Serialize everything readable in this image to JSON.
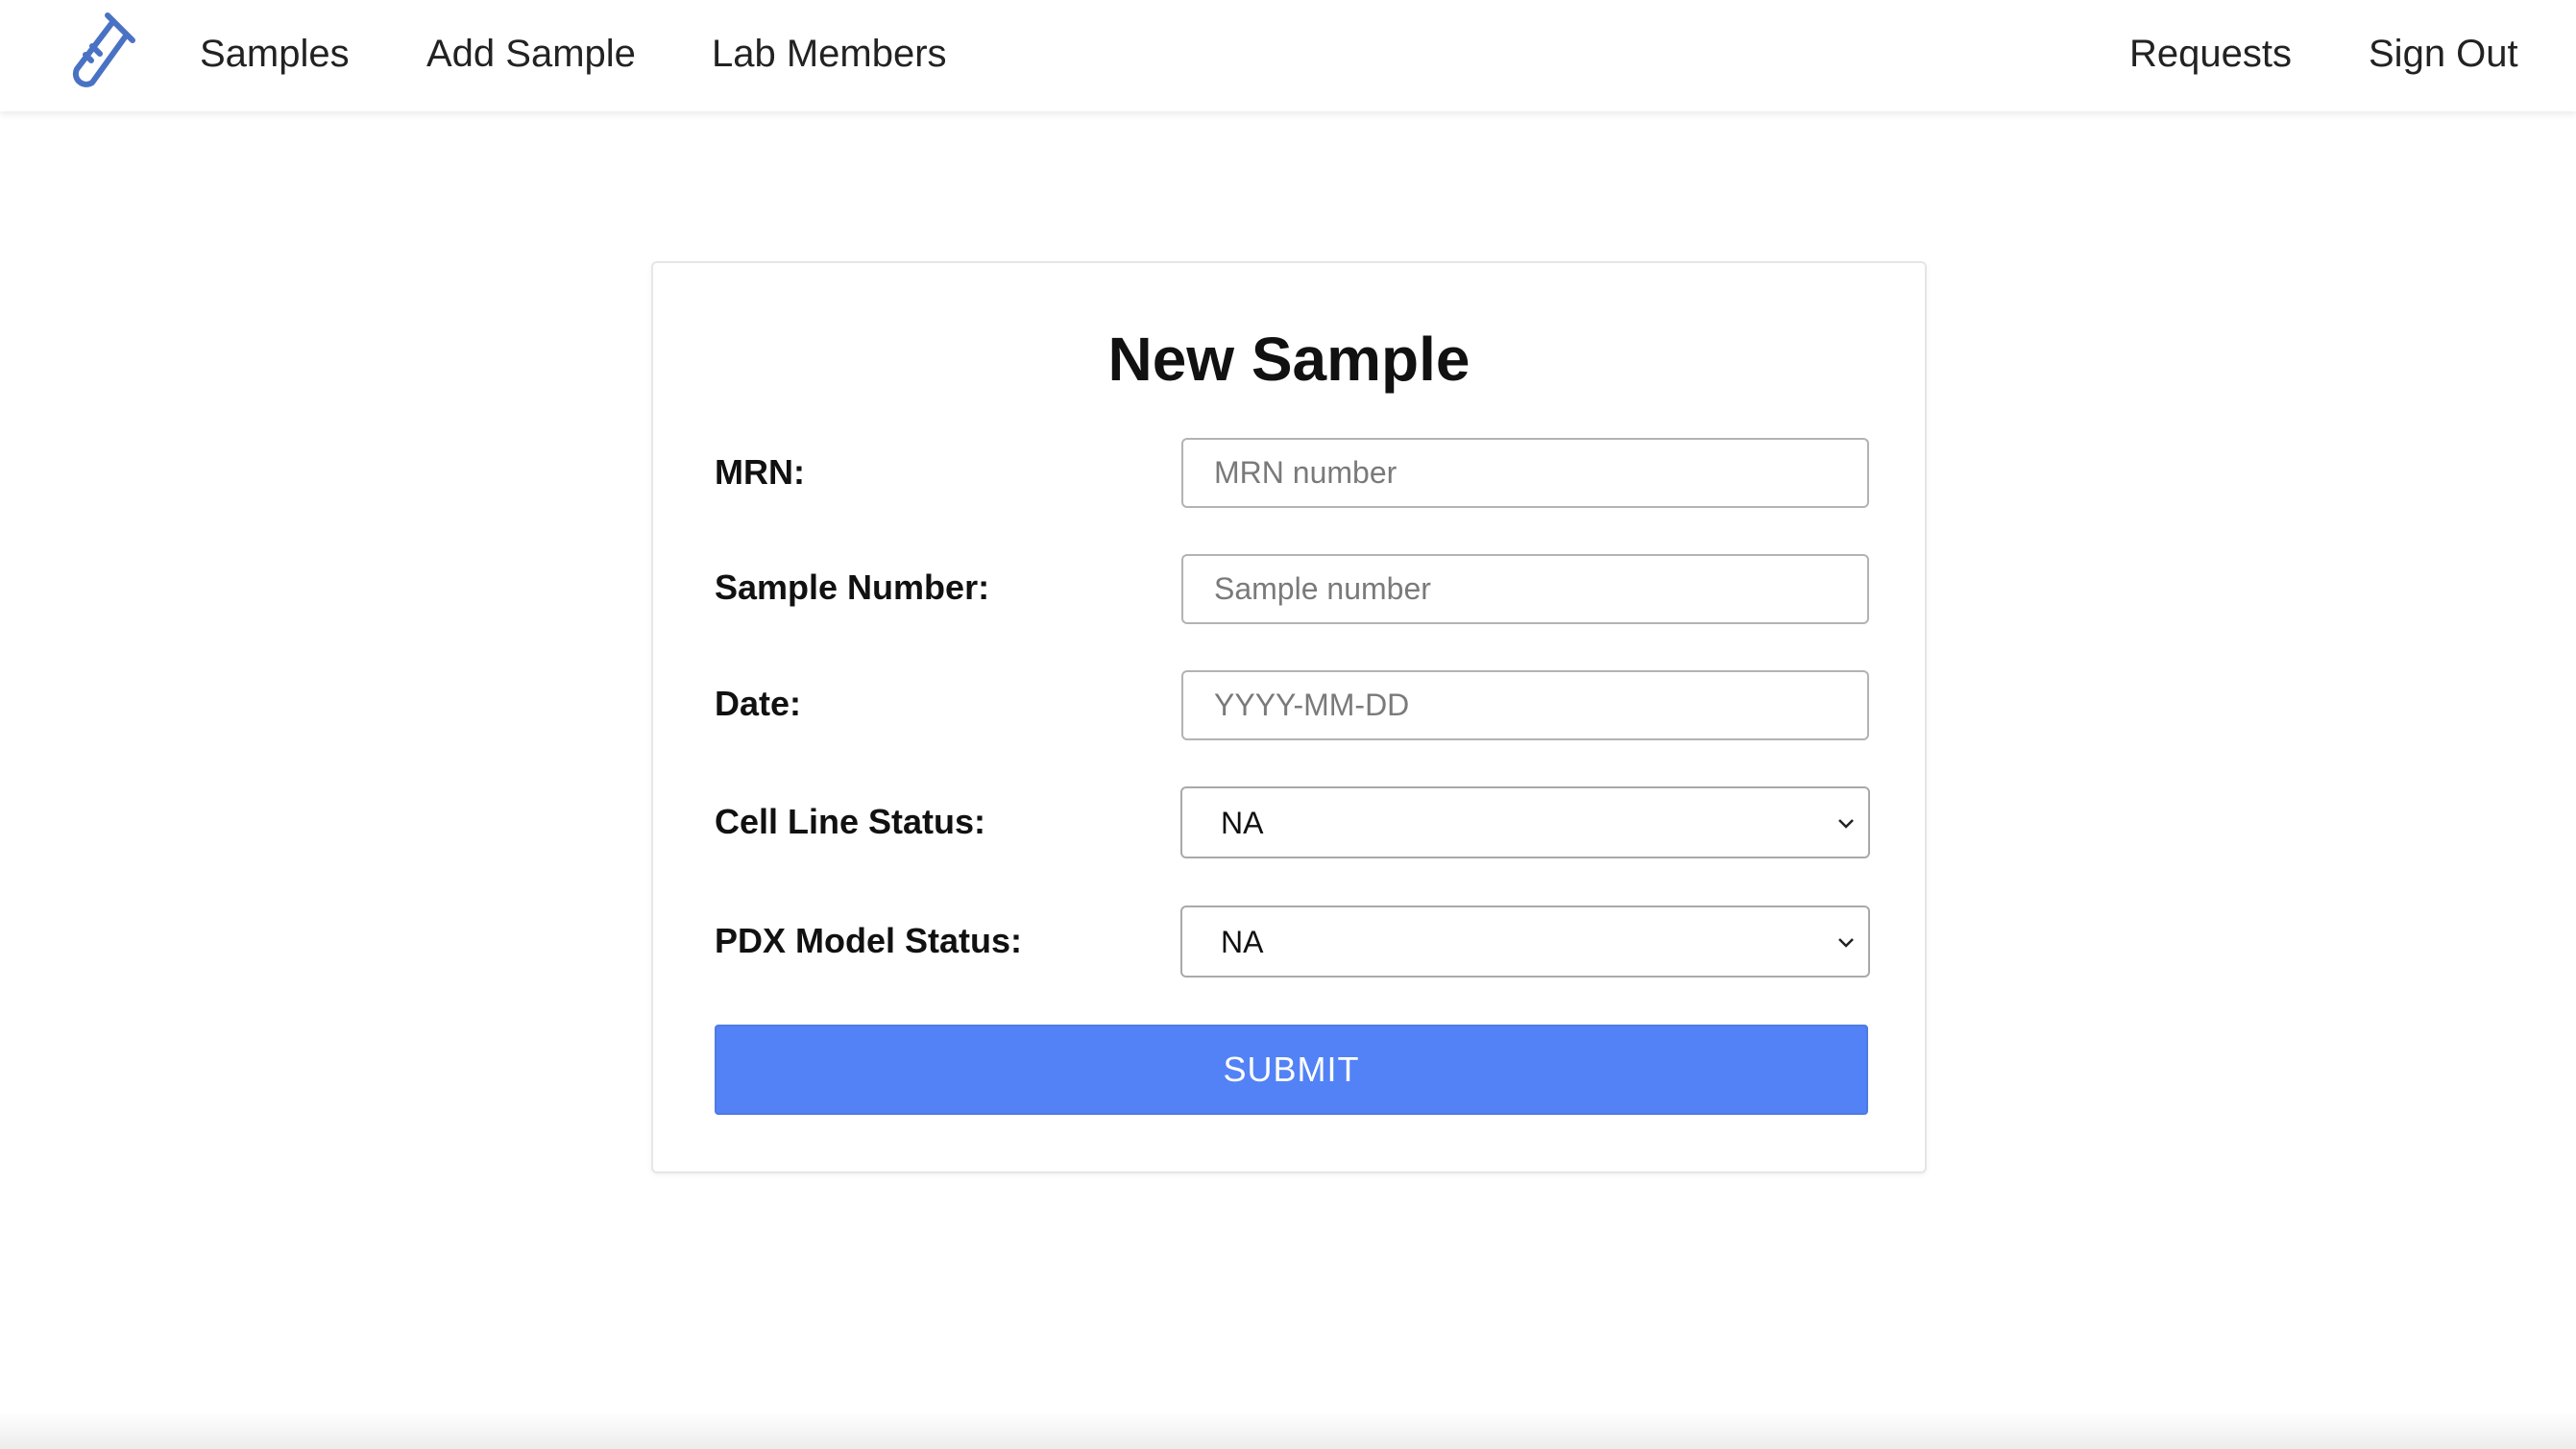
{
  "navbar": {
    "logo_icon": "test-tube-icon",
    "brand_color": "#4a72c4",
    "links_left": [
      {
        "label": "Samples"
      },
      {
        "label": "Add Sample"
      },
      {
        "label": "Lab Members"
      }
    ],
    "links_right": [
      {
        "label": "Requests"
      },
      {
        "label": "Sign Out"
      }
    ]
  },
  "form": {
    "title": "New Sample",
    "fields": {
      "mrn": {
        "label": "MRN:",
        "value": "",
        "placeholder": "MRN number"
      },
      "sample_number": {
        "label": "Sample Number:",
        "value": "",
        "placeholder": "Sample number"
      },
      "date": {
        "label": "Date:",
        "value": "",
        "placeholder": "YYYY-MM-DD"
      },
      "cell_line_status": {
        "label": "Cell Line Status:",
        "selected": "NA"
      },
      "pdx_model_status": {
        "label": "PDX Model Status:",
        "selected": "NA"
      }
    },
    "submit_label": "SUBMIT",
    "submit_color": "#5282f6"
  }
}
